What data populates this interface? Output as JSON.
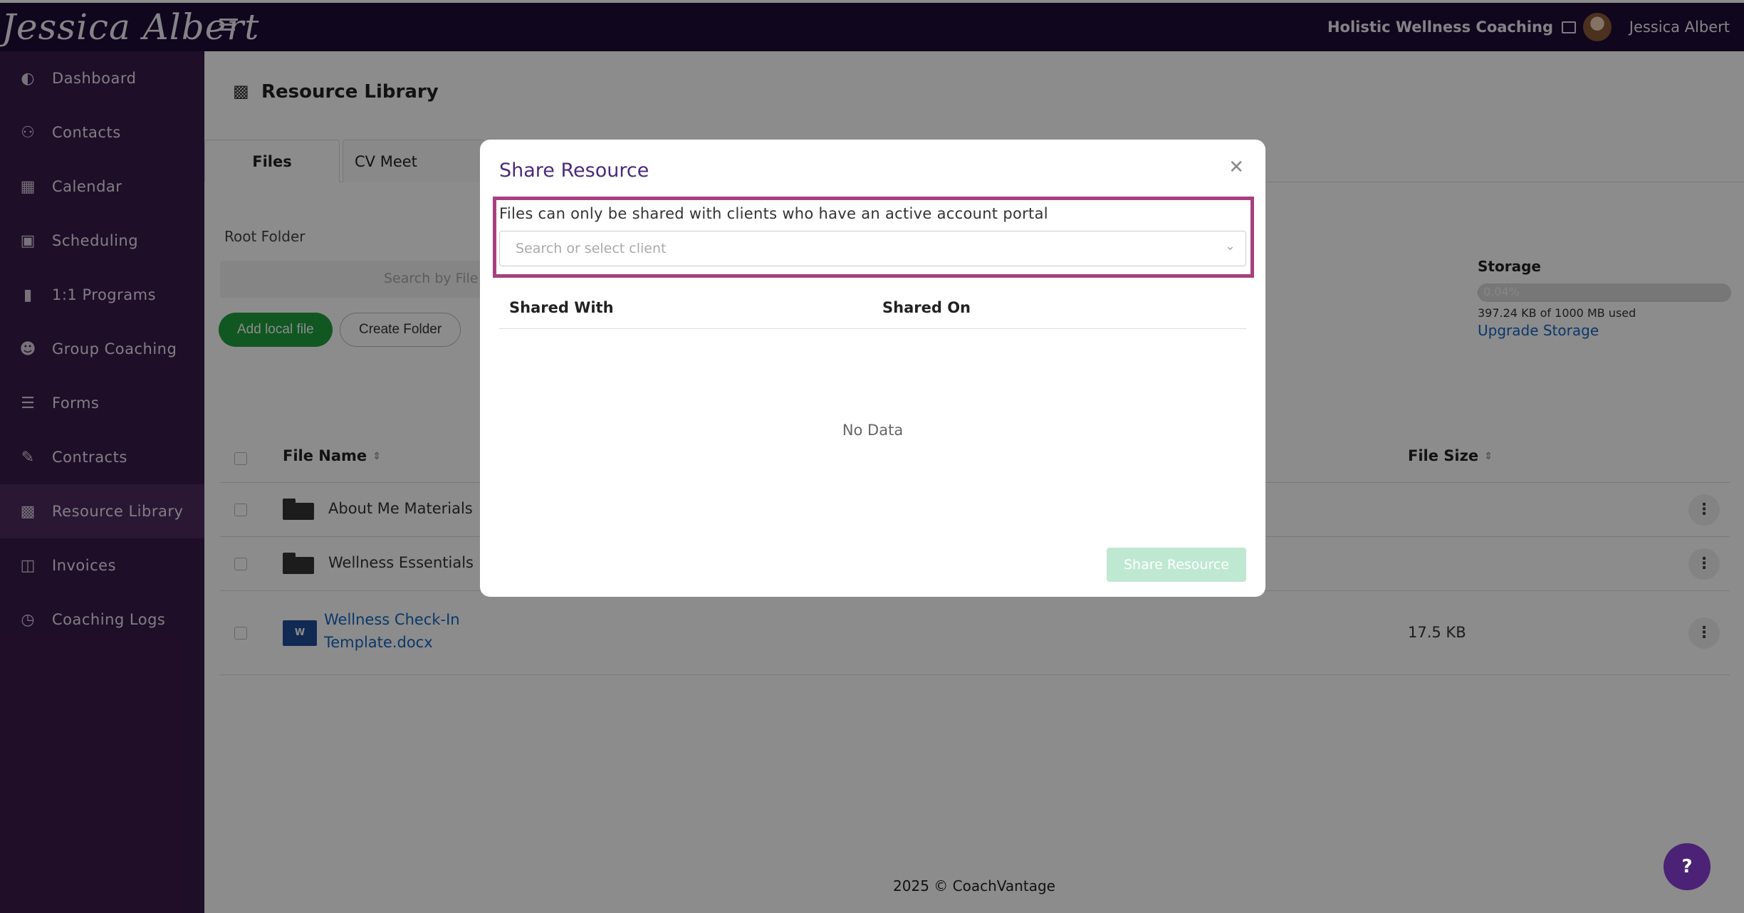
{
  "header": {
    "logo_text": "Jessica Albert",
    "organization": "Holistic Wellness Coaching",
    "user_name": "Jessica Albert"
  },
  "sidebar": {
    "items": [
      {
        "label": "Dashboard",
        "icon": "dashboard-icon"
      },
      {
        "label": "Contacts",
        "icon": "contacts-icon"
      },
      {
        "label": "Calendar",
        "icon": "calendar-icon"
      },
      {
        "label": "Scheduling",
        "icon": "scheduling-icon"
      },
      {
        "label": "1:1 Programs",
        "icon": "programs-icon"
      },
      {
        "label": "Group Coaching",
        "icon": "group-icon"
      },
      {
        "label": "Forms",
        "icon": "forms-icon"
      },
      {
        "label": "Contracts",
        "icon": "contracts-icon"
      },
      {
        "label": "Resource Library",
        "icon": "library-icon",
        "active": true
      },
      {
        "label": "Invoices",
        "icon": "invoices-icon"
      },
      {
        "label": "Coaching Logs",
        "icon": "clock-icon"
      }
    ]
  },
  "main": {
    "title": "Resource Library",
    "tabs": [
      {
        "label": "Files"
      },
      {
        "label": "CV Meet Recordin"
      }
    ],
    "root_folder": "Root Folder",
    "search_placeholder": "Search by File N",
    "add_button": "Add local file",
    "create_folder_button": "Create Folder",
    "storage": {
      "label": "Storage",
      "percent_text": "0.04%",
      "percent": 0.04,
      "used_text": "397.24 KB of 1000 MB used",
      "upgrade_link": "Upgrade Storage"
    },
    "table": {
      "headers": {
        "name": "File Name",
        "size": "File Size"
      },
      "rows": [
        {
          "name": "About Me Materials",
          "type": "folder",
          "size": ""
        },
        {
          "name": "Wellness Essentials",
          "type": "folder",
          "size": ""
        },
        {
          "name": "Wellness Check-In Template.docx",
          "type": "docx",
          "size": "17.5 KB"
        }
      ]
    },
    "footer": "2025 © CoachVantage"
  },
  "modal": {
    "title": "Share Resource",
    "notice": "Files can only be shared with clients who have an active account portal",
    "select_placeholder": "Search or select client",
    "columns": {
      "shared_with": "Shared With",
      "shared_on": "Shared On"
    },
    "empty_text": "No Data",
    "share_button": "Share Resource",
    "highlight_color": "#a8407f"
  },
  "help_button": "?"
}
